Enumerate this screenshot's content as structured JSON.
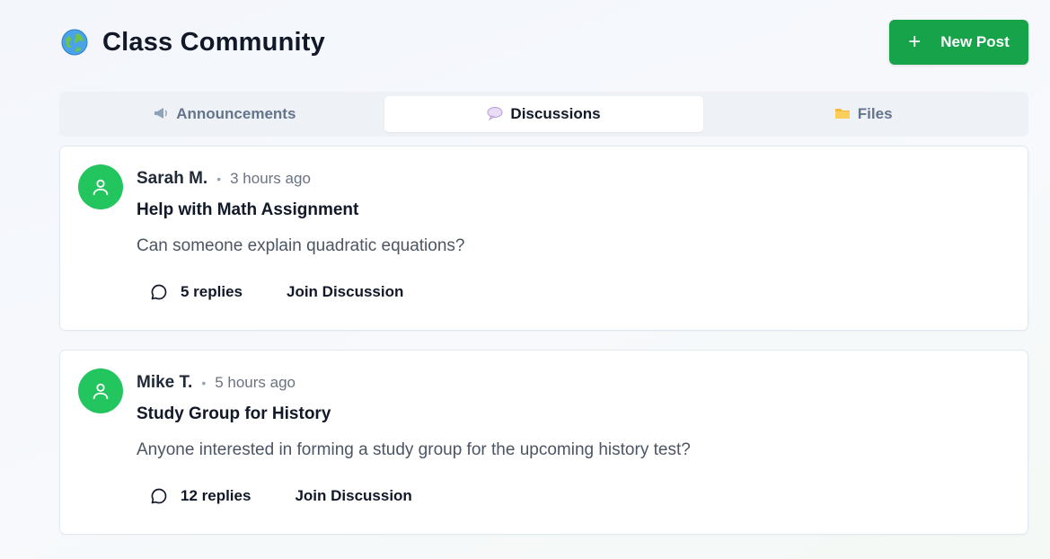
{
  "header": {
    "title": "Class Community",
    "icon": "globe-icon",
    "new_post_label": "New Post",
    "accent": "#16a34a"
  },
  "tabs": [
    {
      "label": "Announcements",
      "icon": "megaphone-icon",
      "active": false
    },
    {
      "label": "Discussions",
      "icon": "speech-bubble-icon",
      "active": true
    },
    {
      "label": "Files",
      "icon": "folder-icon",
      "active": false
    }
  ],
  "posts": [
    {
      "author": "Sarah M.",
      "time": "3 hours ago",
      "title": "Help with Math Assignment",
      "body": "Can someone explain quadratic equations?",
      "replies": "5 replies",
      "join_label": "Join Discussion"
    },
    {
      "author": "Mike T.",
      "time": "5 hours ago",
      "title": "Study Group for History",
      "body": "Anyone interested in forming a study group for the upcoming history test?",
      "replies": "12 replies",
      "join_label": "Join Discussion"
    }
  ],
  "colors": {
    "avatar": "#22c55e",
    "active_tab_bg": "#ffffff",
    "tabbar_bg": "#eef2f7"
  }
}
